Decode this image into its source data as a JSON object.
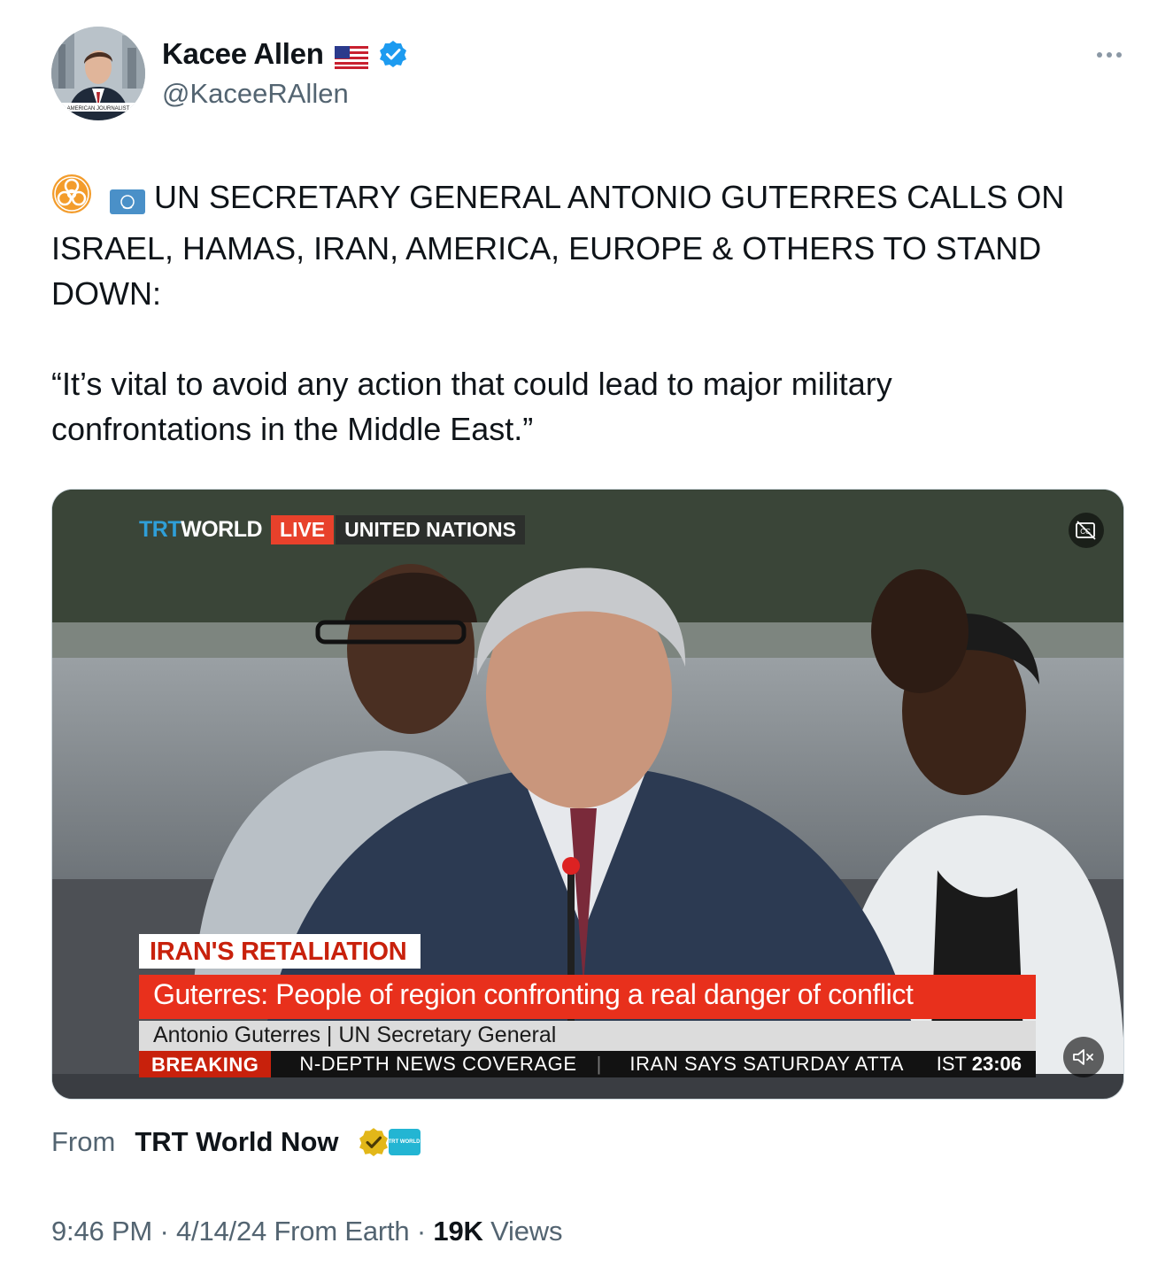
{
  "author": {
    "display_name": "Kacee Allen",
    "handle": "@KaceeRAllen",
    "flag_icon": "us-flag-icon",
    "verified_icon": "blue-verified-badge",
    "avatar_caption": "AMERICAN JOURNALIST"
  },
  "tweet": {
    "line1": "UN SECRETARY GENERAL ANTONIO GUTERRES CALLS ON",
    "line2": "ISRAEL, HAMAS, IRAN, AMERICA, EUROPE & OTHERS TO STAND",
    "line3": "DOWN:",
    "quote1": "“It’s vital to avoid any action that could lead to major military",
    "quote2": "confrontations in the Middle East.”",
    "lead_icons": [
      "biohazard-icon",
      "un-flag-icon"
    ]
  },
  "video": {
    "logo_trt": "TRT",
    "logo_world": "WORLD",
    "live_tag": "LIVE",
    "location_tag": "UNITED NATIONS",
    "headline_tag": "IRAN'S RETALIATION",
    "main_caption": "Guterres: People of region confronting a real danger of conflict",
    "speaker_caption": "Antonio Guterres | UN Secretary General",
    "ticker_label": "BREAKING",
    "ticker_item1": "N-DEPTH NEWS COVERAGE",
    "ticker_item2": "IRAN SAYS SATURDAY ATTA",
    "ticker_tz": "IST",
    "ticker_time": "23:06",
    "cc_icon": "closed-captions-icon",
    "mute_icon": "muted-speaker-icon"
  },
  "source": {
    "prefix": "From",
    "name": "TRT World Now",
    "badge_icon": "gold-verified-badge",
    "affiliate_badge_text": "TRT WORLD"
  },
  "meta": {
    "time_date": "9:46 PM · 4/14/24 From Earth · ",
    "views_count": "19K",
    "views_label": " Views"
  },
  "colors": {
    "text_primary": "#0f1419",
    "text_secondary": "#536471",
    "verified_blue": "#1d9bf0",
    "trt_red": "#e8301c"
  }
}
